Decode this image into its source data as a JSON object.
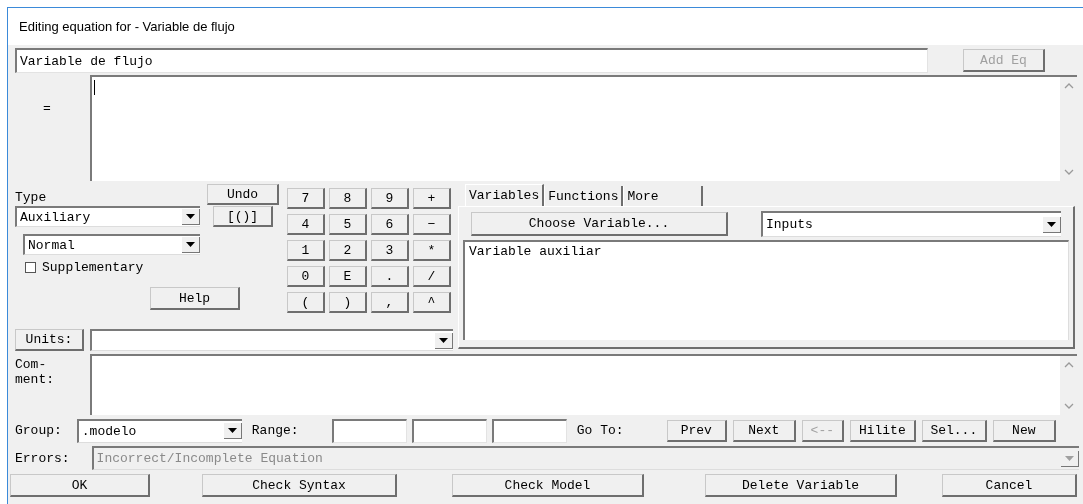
{
  "window": {
    "title": "Editing equation for - Variable de flujo"
  },
  "name_field": {
    "value": "Variable de flujo"
  },
  "add_eq_button": {
    "label": "Add Eq",
    "disabled": true
  },
  "equation": {
    "label": "="
  },
  "type": {
    "label": "Type",
    "dropdown": "Auxiliary",
    "subtype": "Normal"
  },
  "supplementary": {
    "label": "Supplementary",
    "checked": false
  },
  "undo_button": "Undo",
  "brackets_button": "[()]",
  "help_button": "Help",
  "keypad": [
    "7",
    "8",
    "9",
    "+",
    "4",
    "5",
    "6",
    "−",
    "1",
    "2",
    "3",
    "*",
    "0",
    "E",
    ".",
    "/",
    "(",
    ")",
    ",",
    "^"
  ],
  "tabs": [
    {
      "label": "Variables",
      "selected": true
    },
    {
      "label": "Functions",
      "selected": false
    },
    {
      "label": "More",
      "selected": false
    }
  ],
  "choose_variable_button": "Choose Variable...",
  "variable_filter": "Inputs",
  "variable_list": [
    "Variable auxiliar"
  ],
  "units": {
    "label": "Units:"
  },
  "comment": {
    "label_lines": [
      "Com-",
      "ment:"
    ]
  },
  "group": {
    "label": "Group:",
    "value": ".modelo"
  },
  "range": {
    "label": "Range:"
  },
  "go_to": {
    "label": "Go To:",
    "buttons": [
      {
        "label": "Prev",
        "disabled": false
      },
      {
        "label": "Next",
        "disabled": false
      },
      {
        "label": "<--",
        "disabled": true
      },
      {
        "label": "Hilite",
        "disabled": false
      },
      {
        "label": "Sel...",
        "disabled": false
      },
      {
        "label": "New",
        "disabled": false
      }
    ]
  },
  "errors": {
    "label": "Errors:",
    "value": "Incorrect/Incomplete Equation",
    "disabled": true
  },
  "bottom_buttons": [
    "OK",
    "Check Syntax",
    "Check Model",
    "Delete Variable",
    "Cancel"
  ]
}
